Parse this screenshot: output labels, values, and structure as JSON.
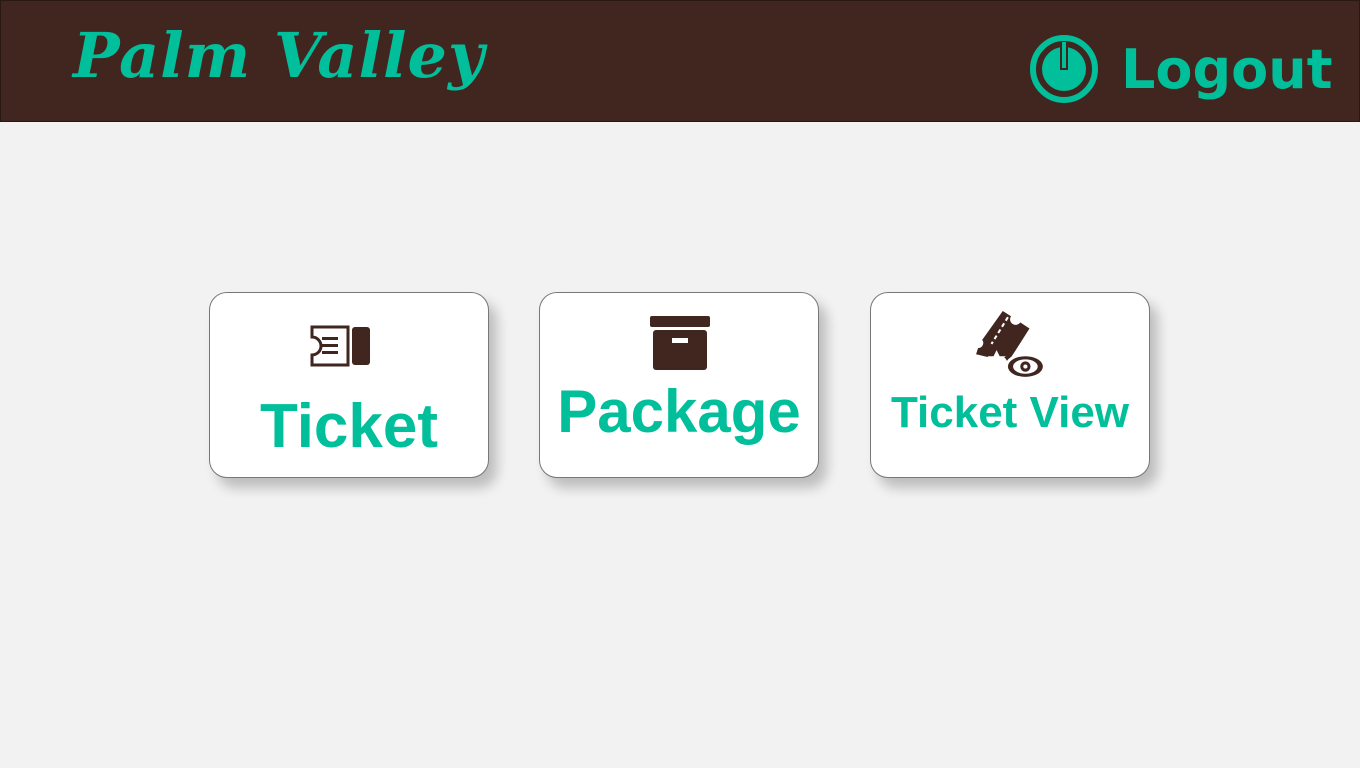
{
  "header": {
    "brand": "Palm Valley",
    "logout_label": "Logout"
  },
  "menu": [
    {
      "label": "Ticket",
      "icon": "ticket-icon"
    },
    {
      "label": "Package",
      "icon": "archive-box-icon"
    },
    {
      "label": "Ticket View",
      "icon": "ticket-view-icon"
    }
  ],
  "colors": {
    "accent": "#00bf9a",
    "header_bg": "#40261f",
    "icon": "#40261f"
  }
}
